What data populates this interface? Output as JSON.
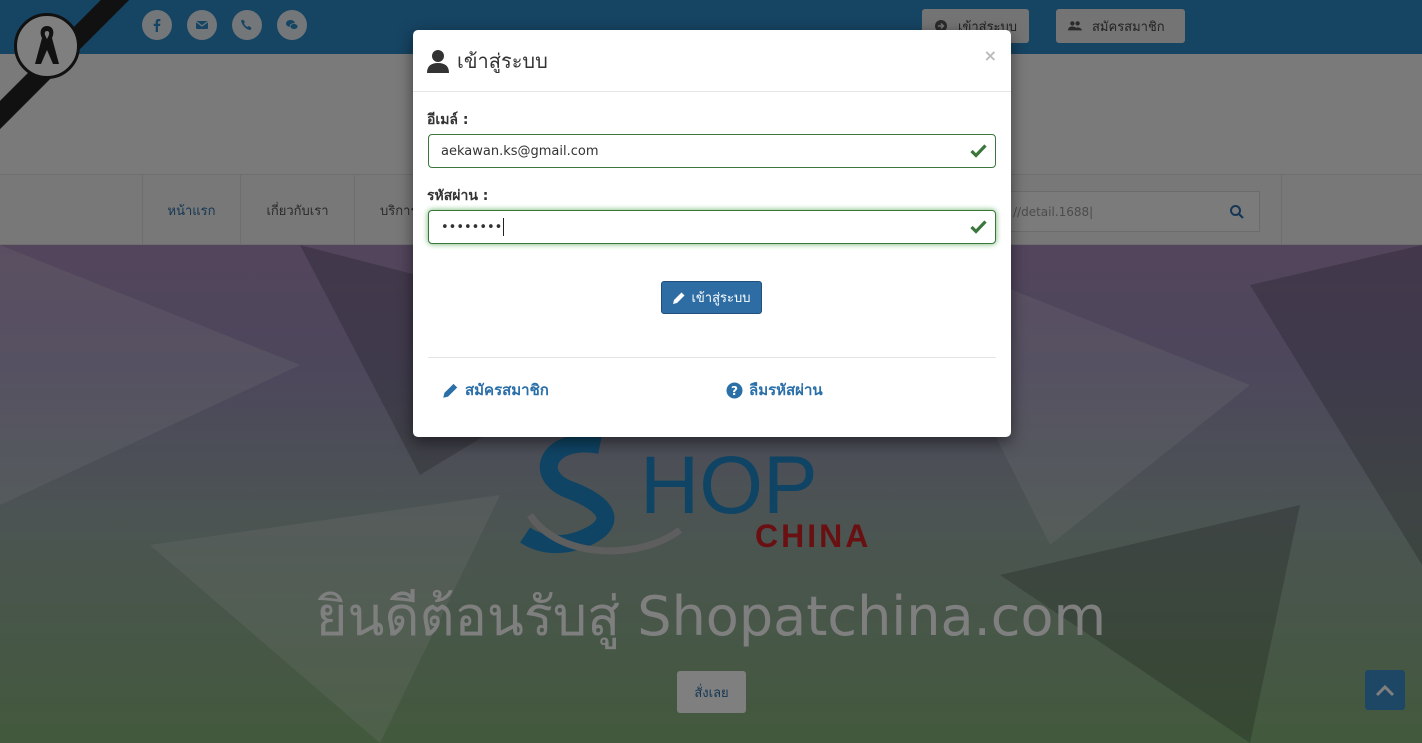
{
  "topbar": {
    "social_icons": [
      "facebook-icon",
      "envelope-icon",
      "phone-icon",
      "wechat-icon"
    ],
    "login_label": "เข้าสู่ระบบ",
    "register_label": "สมัครสมาชิก"
  },
  "nav": {
    "items": [
      {
        "label": "หน้าแรก",
        "active": true
      },
      {
        "label": "เกี่ยวกับเรา",
        "active": false
      },
      {
        "label": "บริการ",
        "active": false
      }
    ],
    "search_value": "//detail.1688|"
  },
  "hero": {
    "logo_main": "HOP",
    "logo_sub": "CHINA",
    "title": "ยินดีต้อนรับสู่ Shopatchina.com",
    "order_label": "สั่งเลย"
  },
  "modal": {
    "title": "เข้าสู่ระบบ",
    "close_label": "×",
    "email_label": "อีเมล์ :",
    "email_value": "aekawan.ks@gmail.com",
    "password_label": "รหัสผ่าน :",
    "password_value": "••••••••",
    "submit_label": "เข้าสู่ระบบ",
    "register_link": "สมัครสมาชิก",
    "forgot_link": "ลืมรหัสผ่าน"
  },
  "colors": {
    "topbar": "#2c89c6",
    "primary": "#2e6da4",
    "link": "#2a6fa8",
    "success": "#3c763d"
  }
}
